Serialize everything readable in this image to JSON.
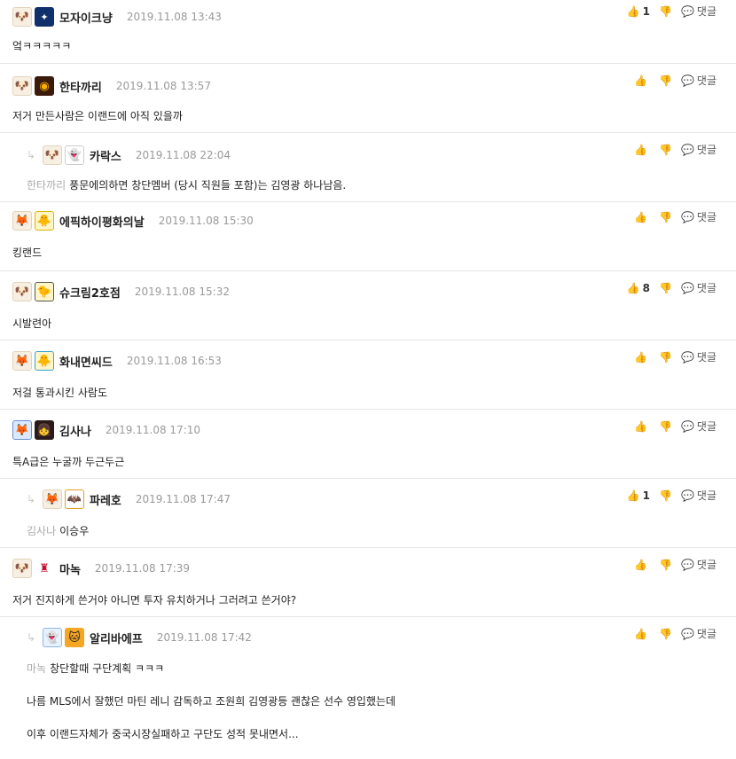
{
  "ui": {
    "reply_label": "댓글"
  },
  "comments": [
    {
      "nick": "모자이크냥",
      "date": "2019.11.08 13:43",
      "likes": "1",
      "text": "엌ㅋㅋㅋㅋㅋ",
      "level_icon": "puppy-face",
      "avatar_icon": "blue-star-avatar"
    },
    {
      "nick": "한타까리",
      "date": "2019.11.08 13:57",
      "likes": "",
      "text": "저거 만든사람은 이랜드에 아직 있을까",
      "level_icon": "puppy-face",
      "avatar_icon": "fire-ball-avatar"
    },
    {
      "nick": "카락스",
      "date": "2019.11.08 22:04",
      "likes": "",
      "mention": "한타까리",
      "text": "풍문에의하면 창단멤버 (당시 직원들 포함)는 김영광 하나남음.",
      "level_icon": "red-puppy-face",
      "avatar_icon": "ghost-avatar"
    },
    {
      "nick": "에픽하이평화의날",
      "date": "2019.11.08 15:30",
      "likes": "",
      "text": "킹랜드",
      "level_icon": "fox-face",
      "avatar_icon": "yellow-chick-avatar"
    },
    {
      "nick": "슈크림2호점",
      "date": "2019.11.08 15:32",
      "likes": "8",
      "text": "시발련아",
      "level_icon": "puppy-face",
      "avatar_icon": "chick-tie-avatar"
    },
    {
      "nick": "화내면씨드",
      "date": "2019.11.08 16:53",
      "likes": "",
      "text": "저걸 통과시킨 사람도",
      "level_icon": "fox-face",
      "avatar_icon": "yellow-chick-avatar"
    },
    {
      "nick": "김사나",
      "date": "2019.11.08 17:10",
      "likes": "",
      "text": "특A급은 누굴까 두근두근",
      "level_icon": "fox-face-blue",
      "avatar_icon": "girl-avatar"
    },
    {
      "nick": "파레호",
      "date": "2019.11.08 17:47",
      "likes": "1",
      "mention": "김사나",
      "text": "이승우",
      "level_icon": "fox-face",
      "avatar_icon": "valencia-bat-avatar"
    },
    {
      "nick": "마녹",
      "date": "2019.11.08 17:39",
      "likes": "",
      "text": "저거 진지하게 쓴거야 아니면 투자 유치하거나 그러려고 쓴거야?",
      "level_icon": "puppy-face",
      "avatar_icon": "liverpool-crest-avatar"
    },
    {
      "nick": "알리바에프",
      "date": "2019.11.08 17:42",
      "likes": "",
      "mention": "마녹",
      "text": "창단할때 구단계획 ㅋㅋㅋ",
      "extra_lines": [
        "나름 MLS에서 잘했던 마틴 레니 감독하고 조원희 김영광등 괜찮은 선수 영입했는데",
        "이후 이랜드자체가 중국시장실패하고 구단도 성적 못내면서..."
      ],
      "level_icon": "ghost-face-blue",
      "avatar_icon": "orange-cat-avatar"
    }
  ]
}
